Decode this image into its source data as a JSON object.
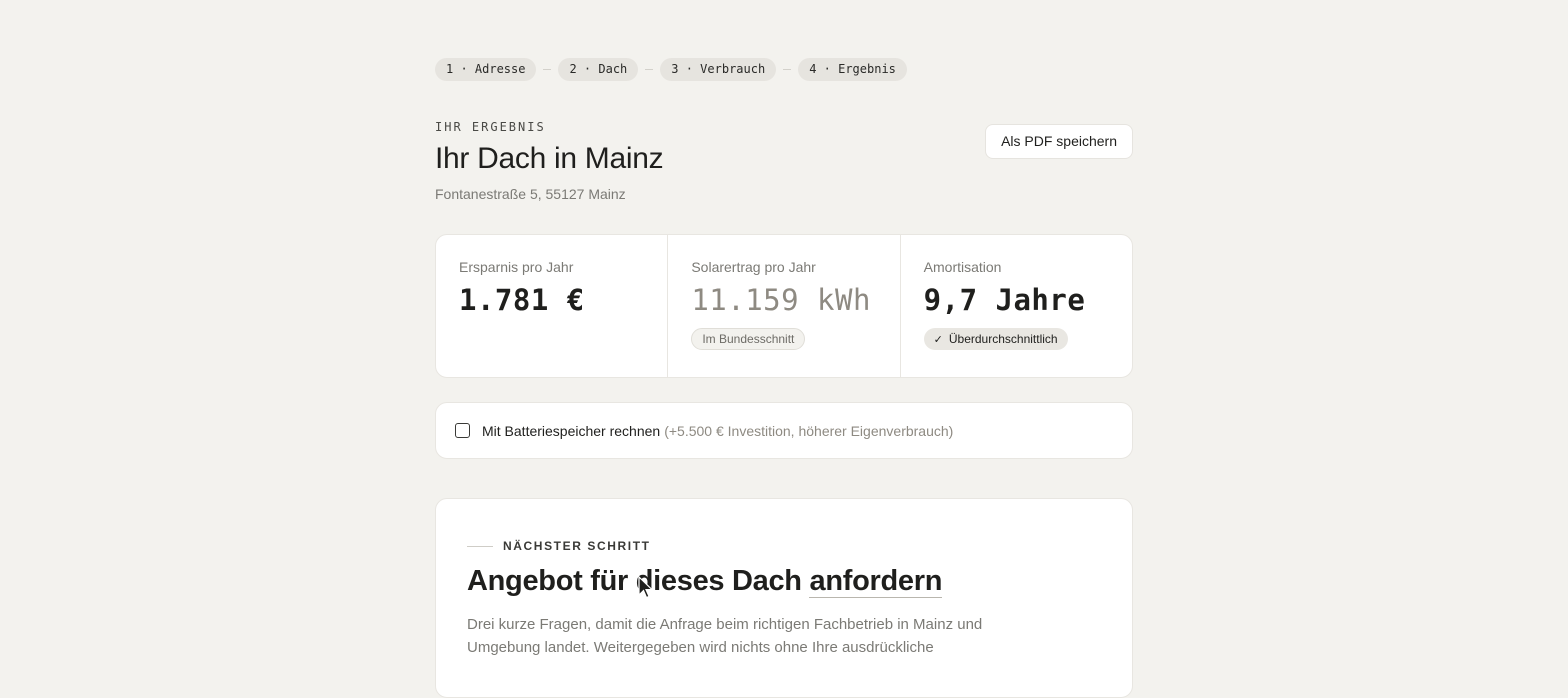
{
  "steps": [
    {
      "label": "1 · Adresse"
    },
    {
      "label": "2 · Dach"
    },
    {
      "label": "3 · Verbrauch"
    },
    {
      "label": "4 · Ergebnis"
    }
  ],
  "header": {
    "eyebrow": "IHR ERGEBNIS",
    "title": "Ihr Dach in Mainz",
    "address": "Fontanestraße 5, 55127 Mainz",
    "pdf_button": "Als PDF speichern"
  },
  "metrics": [
    {
      "label": "Ersparnis pro Jahr",
      "value": "1.781 €",
      "badge": null
    },
    {
      "label": "Solarertrag pro Jahr",
      "value": "11.159 kWh",
      "badge": "Im Bundesschnitt"
    },
    {
      "label": "Amortisation",
      "value": "9,7 Jahre",
      "badge": "Überdurchschnittlich",
      "badge_icon": "check-icon"
    }
  ],
  "battery": {
    "label": "Mit Batteriespeicher rechnen",
    "hint": "(+5.500 € Investition, höherer Eigenverbrauch)",
    "checked": false
  },
  "next_step": {
    "eyebrow": "NÄCHSTER SCHRITT",
    "title_main": "Angebot für dieses Dach ",
    "title_link": "anfordern",
    "description": "Drei kurze Fragen, damit die Anfrage beim richtigen Fachbetrieb in Mainz und Umgebung landet. Weitergegeben wird nichts ohne Ihre ausdrückliche"
  },
  "colors": {
    "background": "#f3f2ee",
    "card": "#ffffff",
    "text": "#1f1f1d",
    "muted": "#7b7a75"
  }
}
